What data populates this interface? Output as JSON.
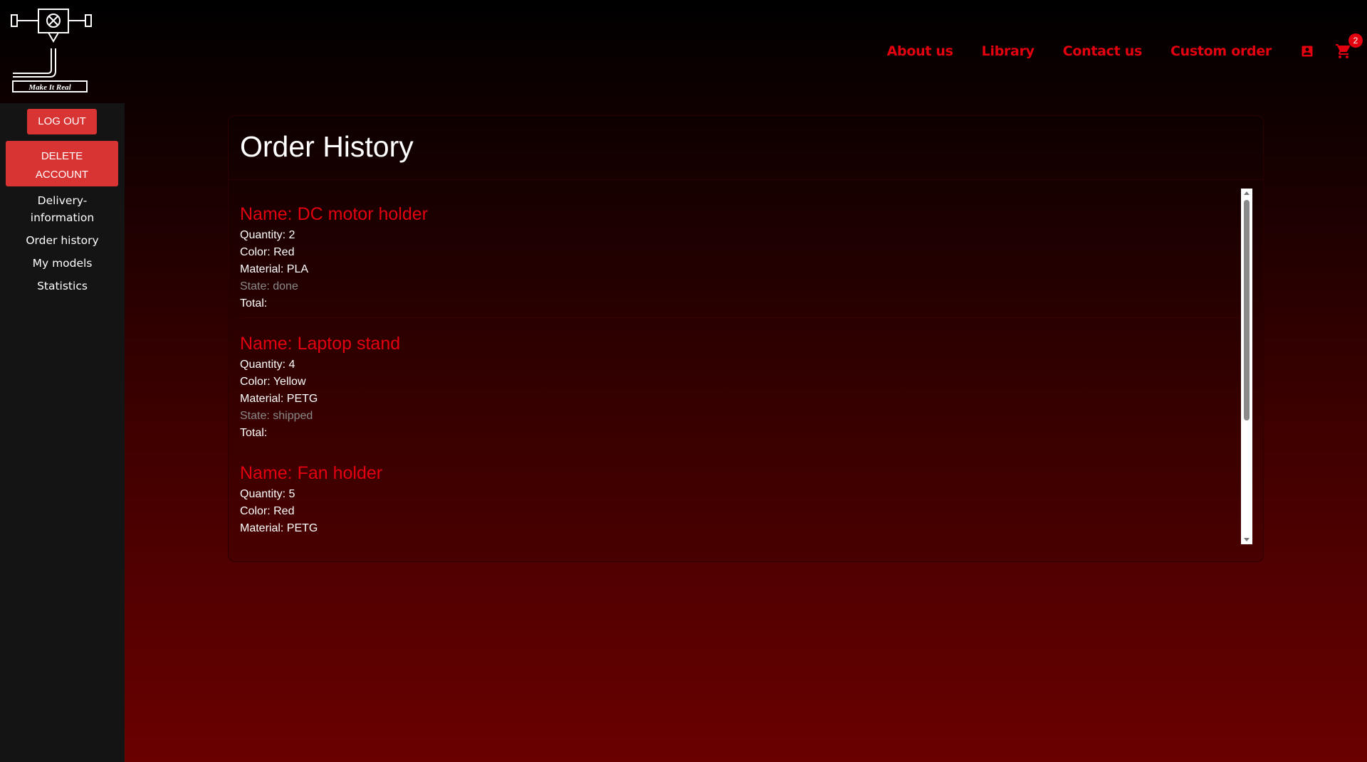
{
  "header": {
    "logo_text": "Make It Real",
    "nav": [
      {
        "label": "About us"
      },
      {
        "label": "Library"
      },
      {
        "label": "Contact us"
      },
      {
        "label": "Custom order"
      }
    ],
    "account_icon": "account-box-icon",
    "cart_icon": "shopping-cart-icon",
    "cart_count": "2",
    "accent_color": "#e3000f"
  },
  "sidebar": {
    "logout_label": "LOG OUT",
    "delete_label_line1": "DELETE",
    "delete_label_line2": "ACCOUNT",
    "links": [
      {
        "label_line1": "Delivery-",
        "label_line2": "information"
      },
      {
        "label": "Order history"
      },
      {
        "label": "My models"
      },
      {
        "label": "Statistics"
      }
    ]
  },
  "main": {
    "title": "Order History",
    "orders": [
      {
        "name": "Name: DC motor holder",
        "quantity": "Quantity: 2",
        "color": "Color: Red",
        "material": "Material: PLA",
        "state": "State: done",
        "total": "Total:"
      },
      {
        "name": "Name: Laptop stand",
        "quantity": "Quantity: 4",
        "color": "Color: Yellow",
        "material": "Material: PETG",
        "state": "State: shipped",
        "total": "Total:"
      },
      {
        "name": "Name: Fan holder",
        "quantity": "Quantity: 5",
        "color": "Color: Red",
        "material": "Material: PETG",
        "state": "",
        "total": ""
      }
    ]
  }
}
